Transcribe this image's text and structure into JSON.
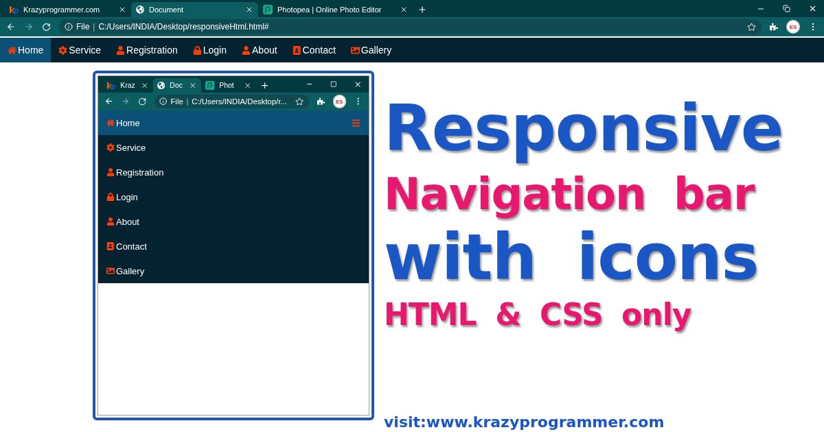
{
  "browser": {
    "tabs": [
      {
        "title": "Krazyprogrammer.com",
        "selected": false
      },
      {
        "title": "Document",
        "selected": true
      },
      {
        "title": "Photopea | Online Photo Editor",
        "selected": false
      }
    ],
    "address": {
      "scheme": "File",
      "separator": "|",
      "url": "C:/Users/INDIA/Desktop/responsiveHtml.html#"
    },
    "profile_initials": "ES"
  },
  "navbar": {
    "items": [
      {
        "label": "Home",
        "selected": true
      },
      {
        "label": "Service",
        "selected": false
      },
      {
        "label": "Registration",
        "selected": false
      },
      {
        "label": "Login",
        "selected": false
      },
      {
        "label": "About",
        "selected": false
      },
      {
        "label": "Contact",
        "selected": false
      },
      {
        "label": "Gallery",
        "selected": false
      }
    ]
  },
  "preview": {
    "tabs": [
      {
        "title": "Kraz",
        "selected": false
      },
      {
        "title": "Doc",
        "selected": true
      },
      {
        "title": "Phot",
        "selected": false
      }
    ],
    "address": {
      "scheme": "File",
      "separator": "|",
      "url": "C:/Users/INDIA/Desktop/r..."
    },
    "profile_initials": "ES",
    "brand": {
      "label": "Home"
    },
    "menu": [
      {
        "label": "Service"
      },
      {
        "label": "Registration"
      },
      {
        "label": "Login"
      },
      {
        "label": "About"
      },
      {
        "label": "Contact"
      },
      {
        "label": "Gallery"
      }
    ]
  },
  "headline": [
    {
      "text": "Responsive",
      "color": "#1a56c4"
    },
    {
      "text": "Navigation bar",
      "color": "#e8186e"
    },
    {
      "text": "with icons",
      "color": "#1a56c4"
    },
    {
      "text": "HTML & CSS only",
      "color": "#e8186e"
    }
  ],
  "footer": {
    "text": "visit:www.krazyprogrammer.com"
  }
}
